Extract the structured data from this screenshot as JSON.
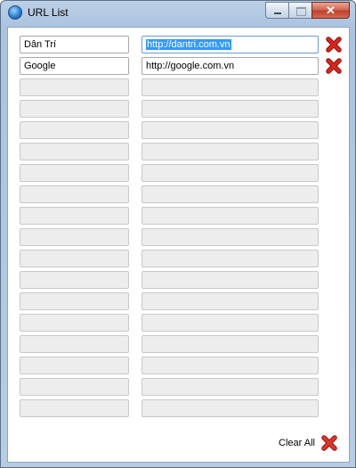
{
  "window": {
    "title": "URL List",
    "close_glyph": "✕"
  },
  "entries": [
    {
      "name": "Dân Trí",
      "url": "http://dantri.com.vn",
      "selected": true
    },
    {
      "name": "Google",
      "url": "http://google.com.vn",
      "selected": false
    }
  ],
  "empty_rows": 16,
  "clear_all_label": "Clear All",
  "colors": {
    "delete_icon": "#d9251b",
    "selection": "#3399ff",
    "empty_field": "#ededed"
  },
  "icons": {
    "app": "globe-icon",
    "delete": "red-x-icon"
  }
}
